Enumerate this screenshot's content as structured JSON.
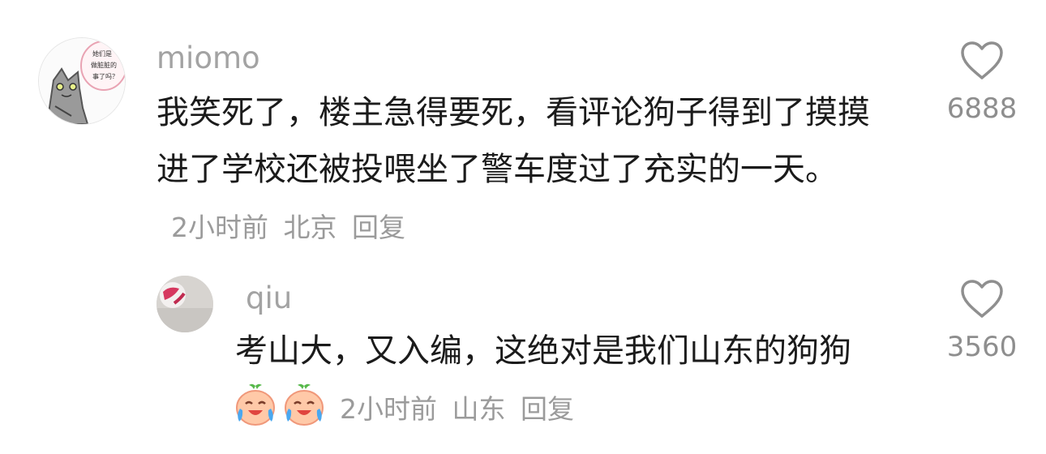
{
  "comments": [
    {
      "username": "miomo",
      "avatar_text": [
        "她们是",
        "做脏脏的",
        "事了吗？"
      ],
      "content": "我笑死了，楼主急得要死，看评论狗子得到了摸摸进了学校还被投喂坐了警车度过了充实的一天。",
      "time": "2小时前",
      "location": "北京",
      "reply_label": "回复",
      "likes": "6888"
    },
    {
      "username": "qiu",
      "content": "考山大，又入编，这绝对是我们山东的狗狗",
      "time": "2小时前",
      "location": "山东",
      "reply_label": "回复",
      "likes": "3560",
      "emojis": [
        "crying-laughing-peach-emoji",
        "crying-laughing-peach-emoji"
      ]
    }
  ],
  "colors": {
    "text": "#1b1b1b",
    "username": "#a3a3a3",
    "meta": "#9b9b9b",
    "like_count": "#8e8e8e"
  }
}
